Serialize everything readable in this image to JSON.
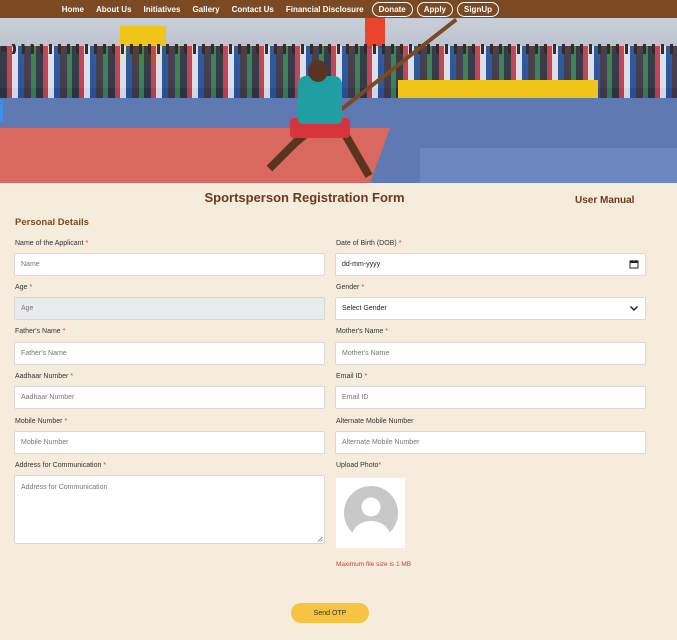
{
  "nav": {
    "links": [
      "Home",
      "About Us",
      "Initiatives",
      "Gallery",
      "Contact Us",
      "Financial Disclosure"
    ],
    "buttons": [
      "Donate",
      "Apply",
      "SignUp"
    ]
  },
  "form": {
    "title": "Sportsperson Registration Form",
    "user_manual": "User Manual",
    "section": "Personal Details",
    "fields": {
      "name": {
        "label": "Name of the Applicant",
        "placeholder": "Name"
      },
      "dob": {
        "label": "Date of Birth (DOB)",
        "value": "dd-mm-yyyy"
      },
      "age": {
        "label": "Age",
        "placeholder": "Age"
      },
      "gender": {
        "label": "Gender",
        "value": "Select Gender"
      },
      "father": {
        "label": "Father's Name",
        "placeholder": "Father's Name"
      },
      "mother": {
        "label": "Mother's Name",
        "placeholder": "Mother's Name"
      },
      "aadhaar": {
        "label": "Aadhaar Number",
        "placeholder": "Aadhaar Number"
      },
      "email": {
        "label": "Email ID",
        "placeholder": "Email ID"
      },
      "mobile": {
        "label": "Mobile Number",
        "placeholder": "Mobile Number"
      },
      "alt_mobile": {
        "label": "Alternate Mobile Number",
        "placeholder": "Alternate Mobile Number"
      },
      "address": {
        "label": "Address for Communication",
        "placeholder": "Address for Communication"
      },
      "photo": {
        "label": "Upload Photo",
        "note": "Maximum file size is 1 MB"
      }
    },
    "required_mark": "*",
    "submit_label": "Send OTP"
  },
  "icons": {
    "calendar": "calendar-icon",
    "chevron": "chevron-down-icon",
    "avatar": "avatar-placeholder-icon"
  },
  "colors": {
    "nav_bg": "#7b4a22",
    "page_bg": "#f5ecdc",
    "accent_text": "#6b3a1e",
    "button": "#f5c443",
    "required": "#d23c3c"
  }
}
